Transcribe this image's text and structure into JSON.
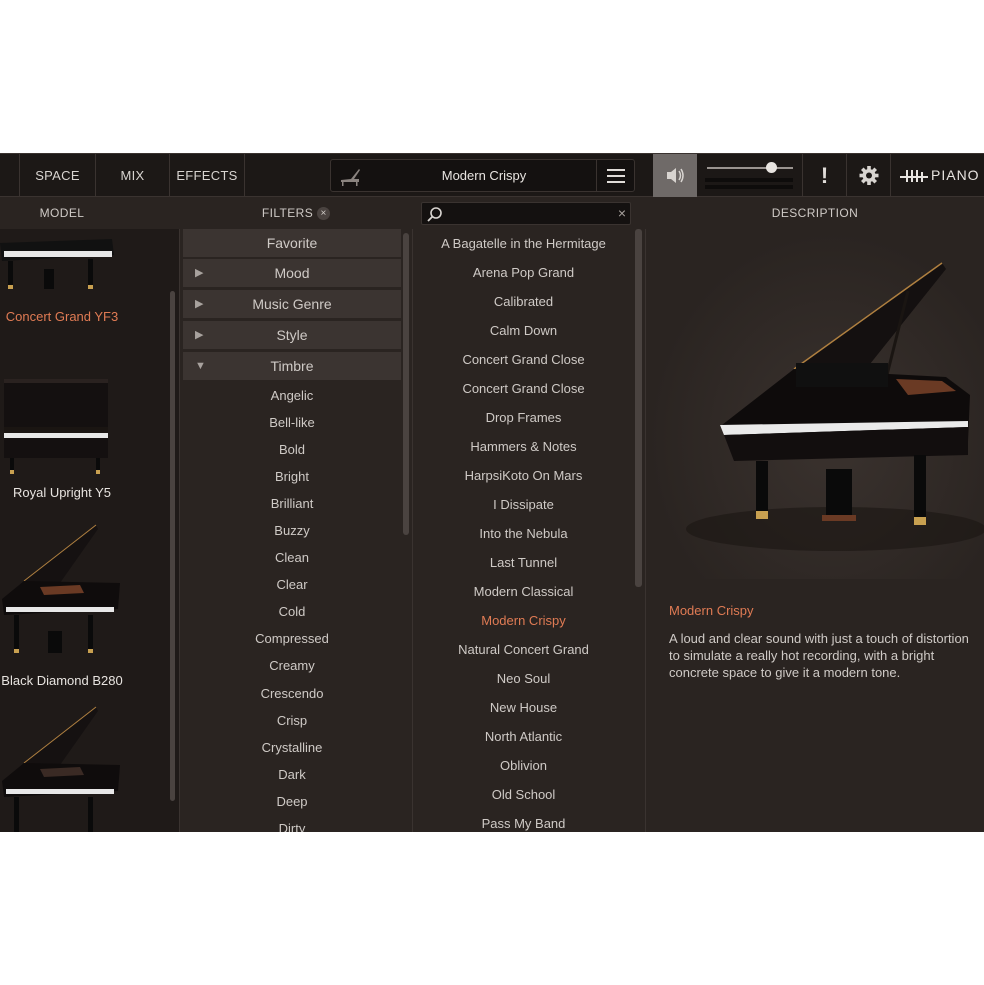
{
  "topbar": {
    "tabs": [
      {
        "label": "SPACE"
      },
      {
        "label": "MIX"
      },
      {
        "label": "EFFECTS"
      }
    ],
    "current_preset": "Modern Crispy",
    "brand_text": "PIANO",
    "icons": {
      "preset_menu": "hamburger-menu-icon",
      "speaker": "speaker-icon",
      "alert": "exclamation-icon",
      "settings": "gear-icon",
      "brand": "pianoverse-logo-icon"
    },
    "volume_level": 0.75
  },
  "columns": {
    "model": "MODEL",
    "filters": "FILTERS",
    "filters_clear": "×",
    "description": "DESCRIPTION"
  },
  "search": {
    "placeholder": "",
    "value": "",
    "clear": "×"
  },
  "models": [
    {
      "label": "Concert Grand YF3",
      "active": true
    },
    {
      "label": "Royal Upright Y5",
      "active": false
    },
    {
      "label": "Black Diamond B280",
      "active": false
    }
  ],
  "filters": {
    "headers": [
      {
        "label": "Favorite",
        "arrow": ""
      },
      {
        "label": "Mood",
        "arrow": "▶"
      },
      {
        "label": "Music Genre",
        "arrow": "▶"
      },
      {
        "label": "Style",
        "arrow": "▶"
      },
      {
        "label": "Timbre",
        "arrow": "▼"
      }
    ],
    "timbre_items": [
      "Angelic",
      "Bell-like",
      "Bold",
      "Bright",
      "Brilliant",
      "Buzzy",
      "Clean",
      "Clear",
      "Cold",
      "Compressed",
      "Creamy",
      "Crescendo",
      "Crisp",
      "Crystalline",
      "Dark",
      "Deep",
      "Dirty"
    ]
  },
  "presets": {
    "items": [
      "A Bagatelle in the Hermitage",
      "Arena Pop Grand",
      "Calibrated",
      "Calm Down",
      "Concert Grand Close",
      "Concert Grand Close",
      "Drop Frames",
      "Hammers & Notes",
      "HarpsiKoto On Mars",
      "I Dissipate",
      "Into the Nebula",
      "Last Tunnel",
      "Modern Classical",
      "Modern Crispy",
      "Natural Concert Grand",
      "Neo Soul",
      "New House",
      "North Atlantic",
      "Oblivion",
      "Old School",
      "Pass My Band"
    ],
    "selected": "Modern Crispy"
  },
  "description": {
    "title": "Modern Crispy",
    "text": "A loud and clear sound with just a touch of distortion to simulate a really hot recording, with a bright concrete space to give it a modern tone."
  },
  "colors": {
    "accent": "#e07b54",
    "background": "#2a2421",
    "topbar": "#1c1816"
  }
}
